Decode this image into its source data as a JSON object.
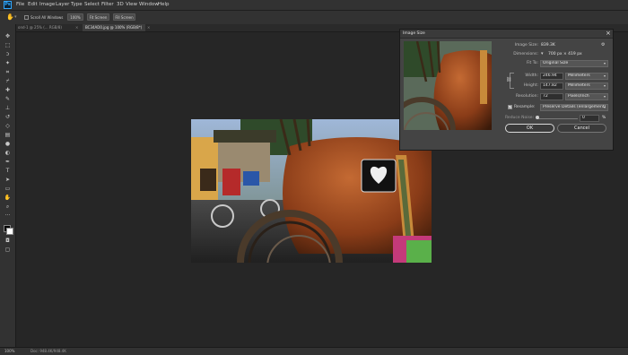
{
  "menubar": {
    "items": [
      "File",
      "Edit",
      "Image",
      "Layer",
      "Type",
      "Select",
      "Filter",
      "3D",
      "View",
      "Window",
      "Help"
    ],
    "logo": "Ps"
  },
  "options": {
    "scroll_all": "Scroll All Windows",
    "zoom_100": "100%",
    "fit_screen": "Fit Screen",
    "fill_screen": "Fill Screen"
  },
  "tabs": [
    {
      "label": "ond-1 @ 25% (... RGB/8)",
      "active": false
    },
    {
      "label": "BC34AD0.jpg @ 100% (RGB/8*)",
      "active": true
    }
  ],
  "status": {
    "zoom": "100%",
    "doc": "Doc: 948.4K/948.4K"
  },
  "dialog": {
    "title": "Image Size",
    "image_size_label": "Image Size:",
    "image_size_value": "839.3K",
    "dimensions_label": "Dimensions:",
    "dimensions_value": "700 px  ×  419 px",
    "fit_to_label": "Fit To:",
    "fit_to_value": "Original Size",
    "width_label": "Width:",
    "width_value": "246.94",
    "width_unit": "Millimeters",
    "height_label": "Height:",
    "height_value": "147.82",
    "height_unit": "Millimeters",
    "resolution_label": "Resolution:",
    "resolution_value": "72",
    "resolution_unit": "Pixels/Inch",
    "resample_label": "Resample:",
    "resample_value": "Preserve Details (enlargement)",
    "reduce_noise_label": "Reduce Noise:",
    "reduce_noise_value": "0",
    "reduce_noise_unit": "%",
    "ok_label": "OK",
    "cancel_label": "Cancel"
  },
  "colors": {
    "accent": "#31a8ff",
    "panel": "#323232",
    "canvas": "#262626",
    "dialog": "#444444"
  }
}
